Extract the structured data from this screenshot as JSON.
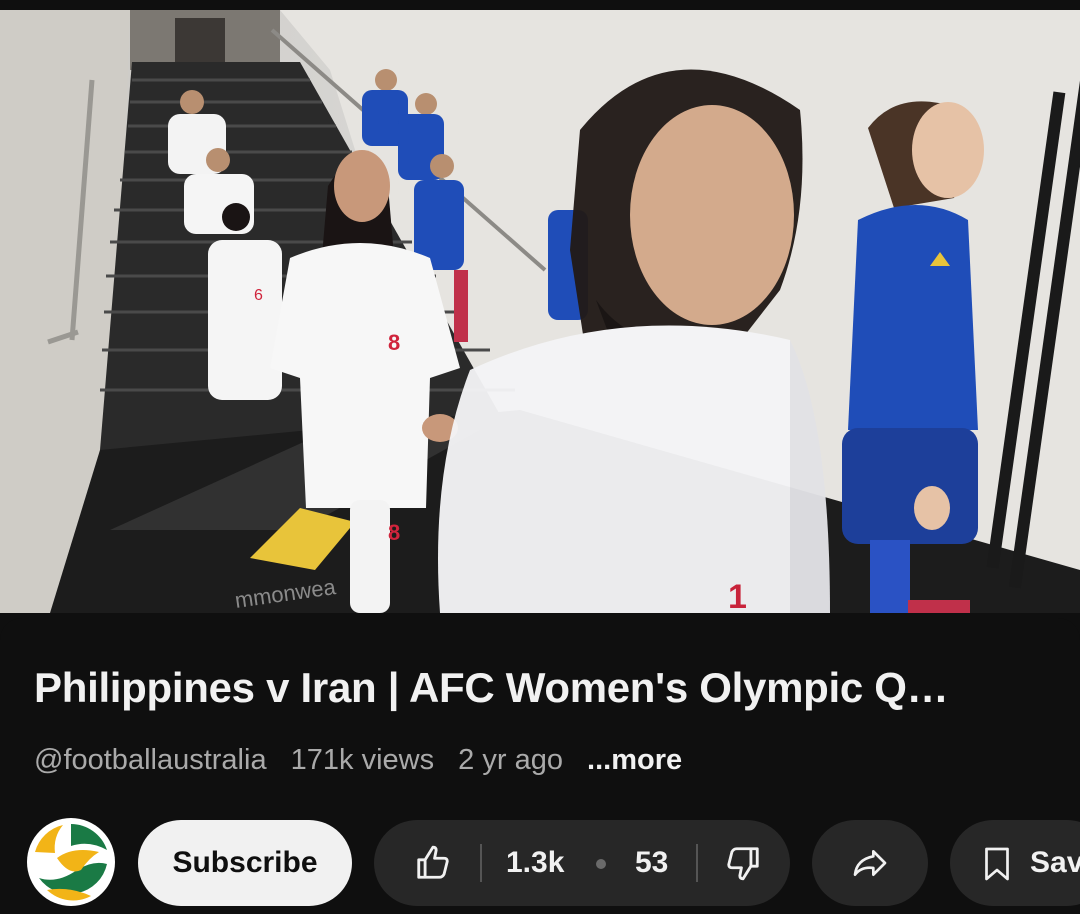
{
  "video": {
    "progress_fraction": 0.018,
    "floor_text": "mmonwea"
  },
  "info": {
    "title": "Philippines v Iran | AFC Women's Olympic Q…",
    "channel_handle": "@footballaustralia",
    "views": "171k views",
    "age": "2 yr ago",
    "more_label": "...more"
  },
  "actions": {
    "subscribe_label": "Subscribe",
    "like_count": "1.3k",
    "dislike_count": "53",
    "save_label": "Save"
  },
  "icons": {
    "avatar": "football-australia-logo",
    "like": "thumbs-up-icon",
    "dislike": "thumbs-down-icon",
    "share": "share-icon",
    "save": "bookmark-icon"
  },
  "colors": {
    "background": "#0f0f0f",
    "pill": "#272727",
    "subscribe_bg": "#f1f1f1",
    "text_secondary": "#aaaaaa",
    "iran_red": "#d0243c",
    "philippines_blue": "#1f4db8",
    "logo_green": "#1a7a45",
    "logo_gold": "#f2b417"
  }
}
